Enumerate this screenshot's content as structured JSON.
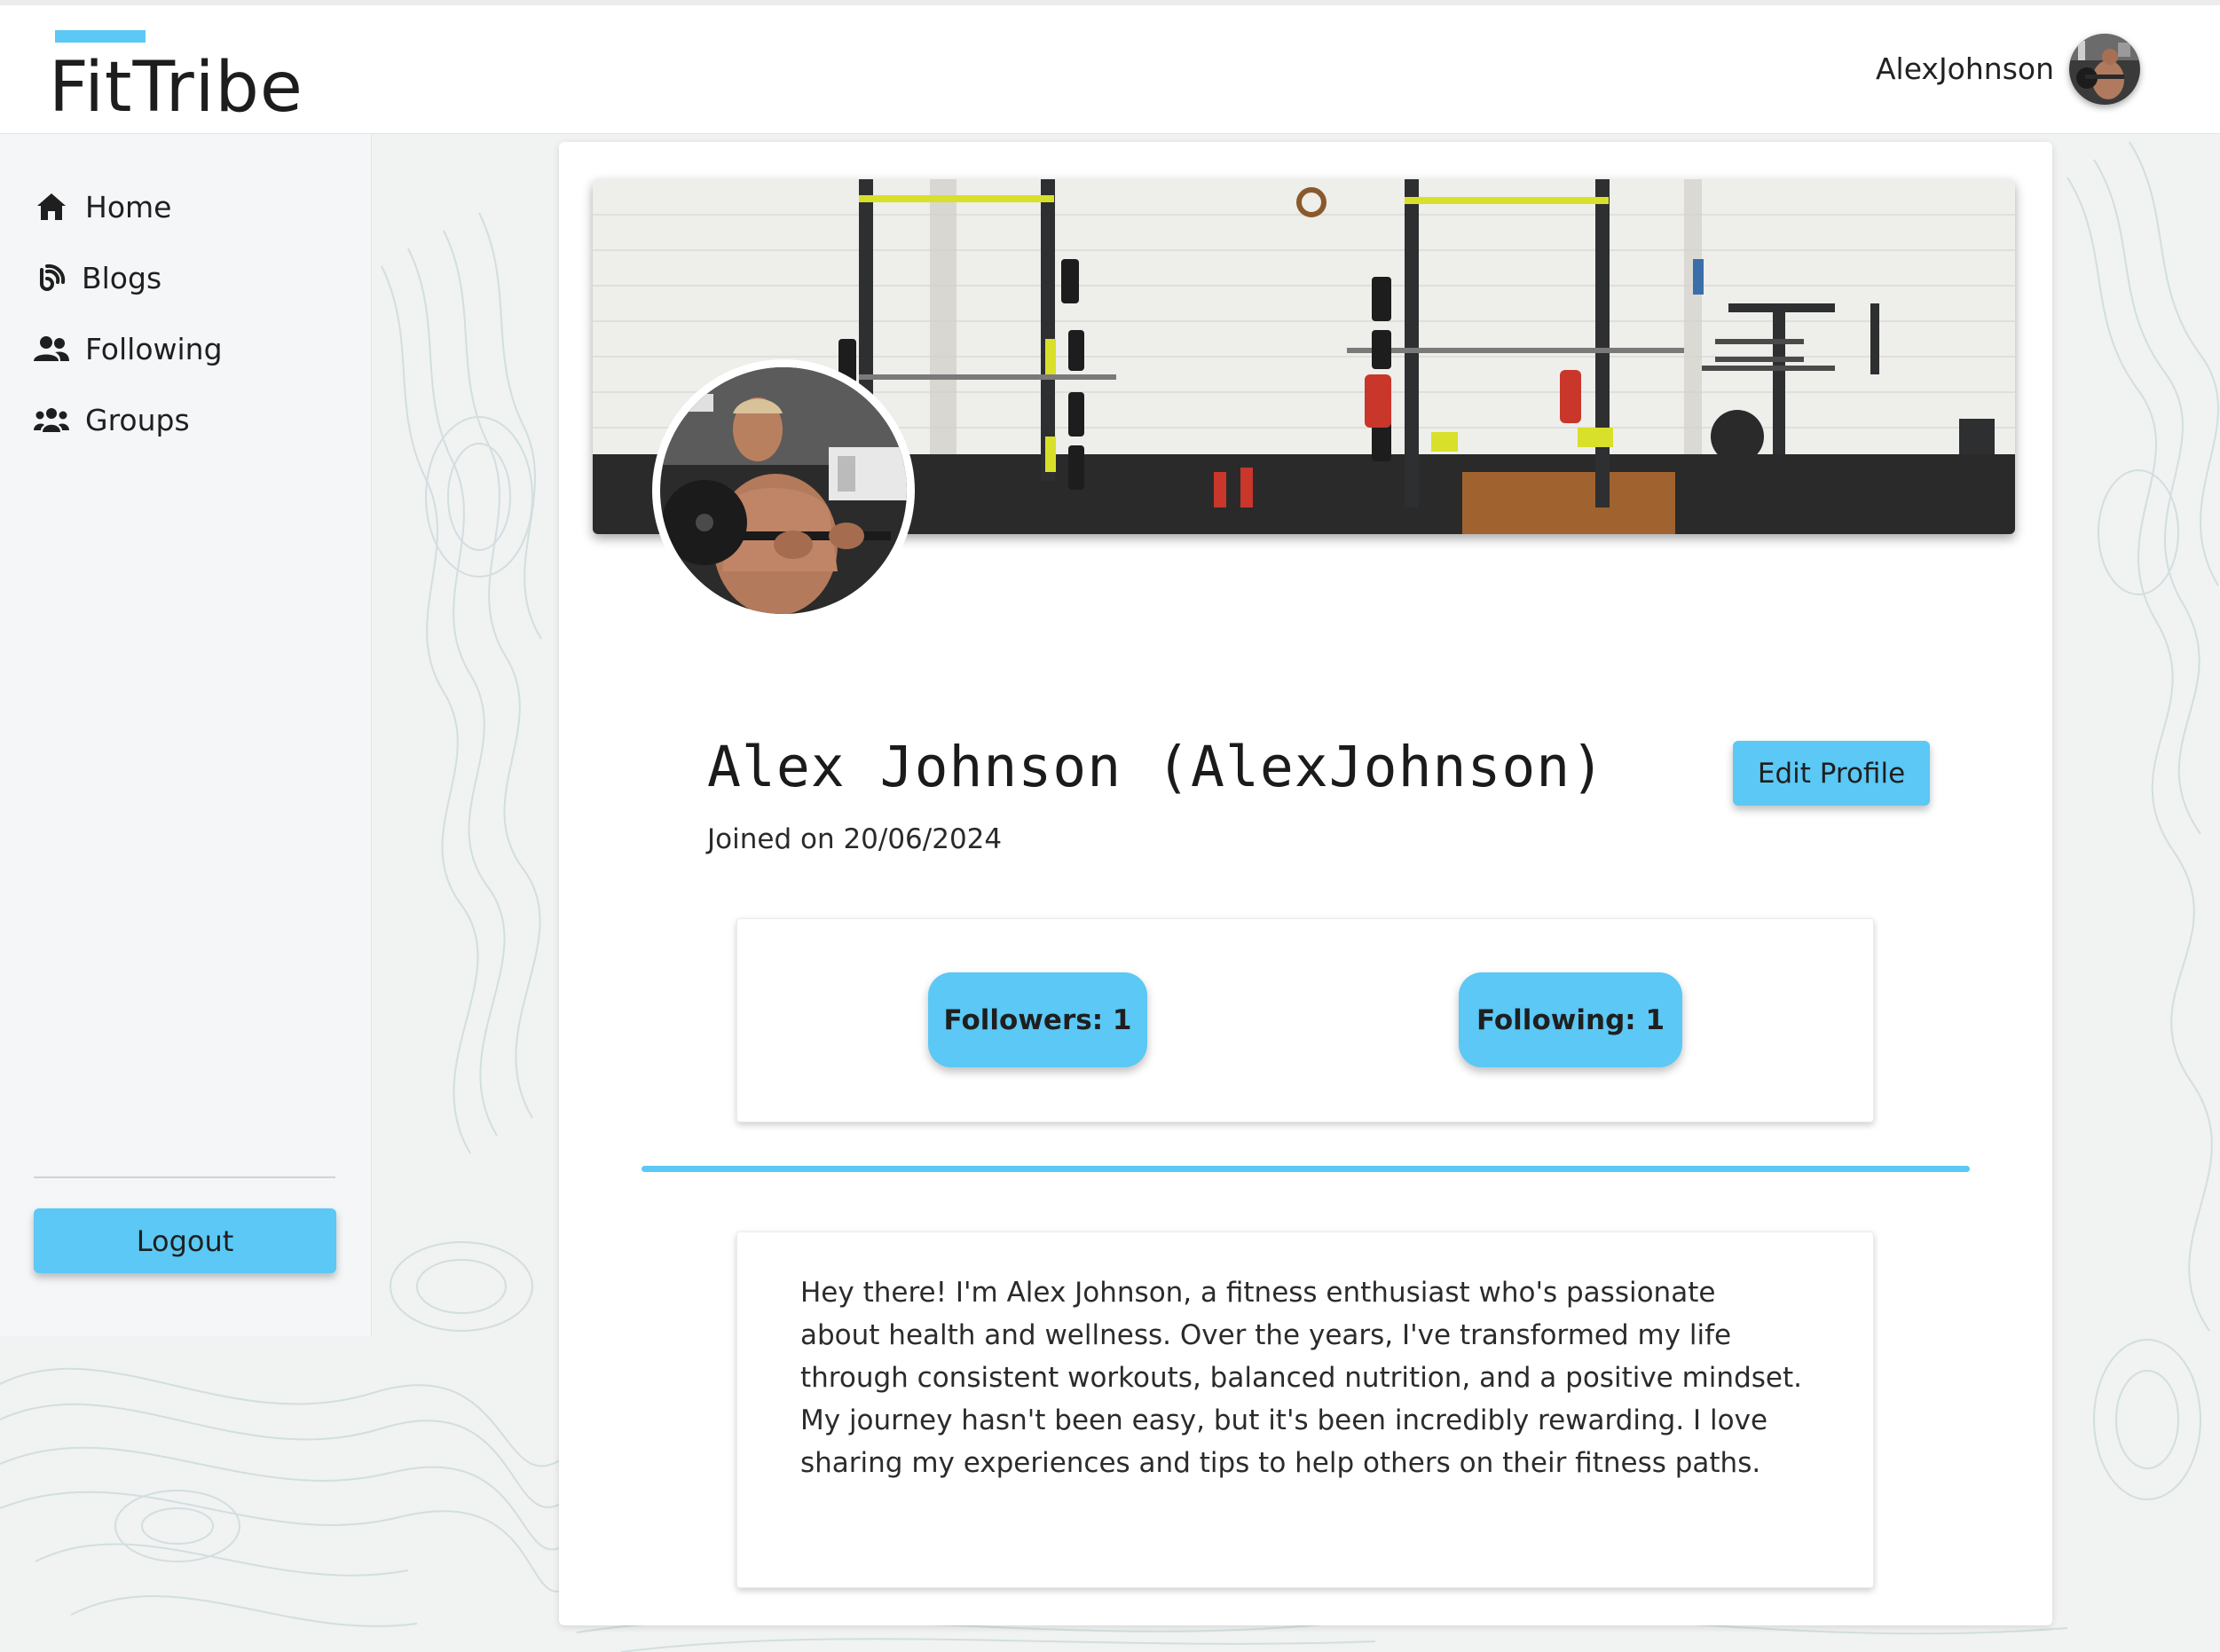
{
  "header": {
    "logo": "FitTribe",
    "username": "AlexJohnson"
  },
  "sidebar": {
    "items": [
      {
        "label": "Home",
        "icon": "home-icon"
      },
      {
        "label": "Blogs",
        "icon": "blog-icon"
      },
      {
        "label": "Following",
        "icon": "user-group-icon"
      },
      {
        "label": "Groups",
        "icon": "users-icon"
      }
    ],
    "logout_label": "Logout"
  },
  "profile": {
    "display_name": "Alex Johnson (AlexJohnson)",
    "joined": "Joined on 20/06/2024",
    "edit_label": "Edit Profile",
    "followers_label": "Followers: 1",
    "following_label": "Following: 1",
    "bio": "Hey there! I'm Alex Johnson, a fitness enthusiast who's passionate about health and wellness. Over the years, I've transformed my life through consistent workouts, balanced nutrition, and a positive mindset. My journey hasn't been easy, but it's been incredibly rewarding. I love sharing my experiences and tips to help others on their fitness paths."
  },
  "colors": {
    "accent": "#5bc8f5",
    "background": "#f1f2f2",
    "sidebar": "#f5f6f8"
  }
}
